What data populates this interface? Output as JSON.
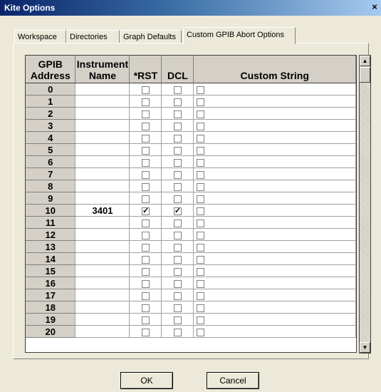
{
  "window": {
    "title": "Kite Options",
    "close": "×"
  },
  "tabs": [
    {
      "label": "Workspace"
    },
    {
      "label": "Directories"
    },
    {
      "label": "Graph Defaults"
    },
    {
      "label": "Custom GPIB Abort Options"
    }
  ],
  "table": {
    "headers": {
      "address": "GPIB Address",
      "name": "Instrument Name",
      "rst": "*RST",
      "dcl": "DCL",
      "custom": "Custom String"
    },
    "rows": [
      {
        "address": "0",
        "name": "",
        "rst": false,
        "dcl": false,
        "custom": false,
        "value": ""
      },
      {
        "address": "1",
        "name": "",
        "rst": false,
        "dcl": false,
        "custom": false,
        "value": ""
      },
      {
        "address": "2",
        "name": "",
        "rst": false,
        "dcl": false,
        "custom": false,
        "value": ""
      },
      {
        "address": "3",
        "name": "",
        "rst": false,
        "dcl": false,
        "custom": false,
        "value": ""
      },
      {
        "address": "4",
        "name": "",
        "rst": false,
        "dcl": false,
        "custom": false,
        "value": ""
      },
      {
        "address": "5",
        "name": "",
        "rst": false,
        "dcl": false,
        "custom": false,
        "value": ""
      },
      {
        "address": "6",
        "name": "",
        "rst": false,
        "dcl": false,
        "custom": false,
        "value": ""
      },
      {
        "address": "7",
        "name": "",
        "rst": false,
        "dcl": false,
        "custom": false,
        "value": ""
      },
      {
        "address": "8",
        "name": "",
        "rst": false,
        "dcl": false,
        "custom": false,
        "value": ""
      },
      {
        "address": "9",
        "name": "",
        "rst": false,
        "dcl": false,
        "custom": false,
        "value": ""
      },
      {
        "address": "10",
        "name": "3401",
        "rst": true,
        "dcl": true,
        "custom": false,
        "value": ""
      },
      {
        "address": "11",
        "name": "",
        "rst": false,
        "dcl": false,
        "custom": false,
        "value": ""
      },
      {
        "address": "12",
        "name": "",
        "rst": false,
        "dcl": false,
        "custom": false,
        "value": ""
      },
      {
        "address": "13",
        "name": "",
        "rst": false,
        "dcl": false,
        "custom": false,
        "value": ""
      },
      {
        "address": "14",
        "name": "",
        "rst": false,
        "dcl": false,
        "custom": false,
        "value": ""
      },
      {
        "address": "15",
        "name": "",
        "rst": false,
        "dcl": false,
        "custom": false,
        "value": ""
      },
      {
        "address": "16",
        "name": "",
        "rst": false,
        "dcl": false,
        "custom": false,
        "value": ""
      },
      {
        "address": "17",
        "name": "",
        "rst": false,
        "dcl": false,
        "custom": false,
        "value": ""
      },
      {
        "address": "18",
        "name": "",
        "rst": false,
        "dcl": false,
        "custom": false,
        "value": ""
      },
      {
        "address": "19",
        "name": "",
        "rst": false,
        "dcl": false,
        "custom": false,
        "value": ""
      },
      {
        "address": "20",
        "name": "",
        "rst": false,
        "dcl": false,
        "custom": false,
        "value": ""
      }
    ]
  },
  "buttons": {
    "ok": "OK",
    "cancel": "Cancel"
  },
  "scroll": {
    "up": "▲",
    "down": "▼"
  },
  "checkmark": "✓"
}
